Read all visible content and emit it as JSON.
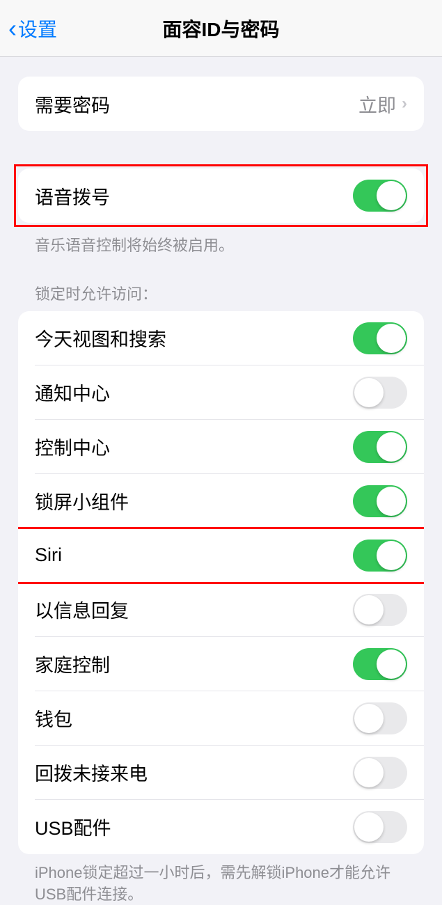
{
  "header": {
    "back_label": "设置",
    "title": "面容ID与密码"
  },
  "require_passcode": {
    "label": "需要密码",
    "value": "立即"
  },
  "voice_dial": {
    "label": "语音拨号",
    "footer": "音乐语音控制将始终被启用。"
  },
  "lock_access": {
    "header": "锁定时允许访问：",
    "items": [
      {
        "label": "今天视图和搜索",
        "on": true
      },
      {
        "label": "通知中心",
        "on": false
      },
      {
        "label": "控制中心",
        "on": true
      },
      {
        "label": "锁屏小组件",
        "on": true
      },
      {
        "label": "Siri",
        "on": true
      },
      {
        "label": "以信息回复",
        "on": false
      },
      {
        "label": "家庭控制",
        "on": true
      },
      {
        "label": "钱包",
        "on": false
      },
      {
        "label": "回拨未接来电",
        "on": false
      },
      {
        "label": "USB配件",
        "on": false
      }
    ],
    "footer": "iPhone锁定超过一小时后，需先解锁iPhone才能允许USB配件连接。"
  }
}
